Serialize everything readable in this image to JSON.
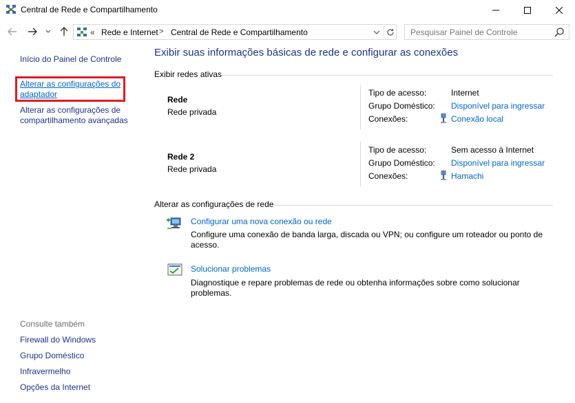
{
  "window": {
    "title": "Central de Rede e Compartilhamento"
  },
  "address": {
    "overflow": "«",
    "crumb1": "Rede e Internet",
    "separator": ">",
    "crumb2": "Central de Rede e Compartilhamento"
  },
  "search": {
    "placeholder": "Pesquisar Painel de Controle"
  },
  "sidebar": {
    "home": "Início do Painel de Controle",
    "adapter": "Alterar as configurações do adaptador",
    "advanced": "Alterar as configurações de compartilhamento avançadas",
    "see_also_title": "Consulte também",
    "see_also": [
      "Firewall do Windows",
      "Grupo Doméstico",
      "Infravermelho",
      "Opções da Internet"
    ]
  },
  "main": {
    "title": "Exibir suas informações básicas de rede e configurar as conexões",
    "active_networks_title": "Exibir redes ativas",
    "networks": [
      {
        "name": "Rede",
        "type": "Rede privada",
        "access_label": "Tipo de acesso:",
        "access_value": "Internet",
        "homegroup_label": "Grupo Doméstico:",
        "homegroup_value": "Disponível para ingressar",
        "connections_label": "Conexões:",
        "connections_value": "Conexão local"
      },
      {
        "name": "Rede  2",
        "type": "Rede privada",
        "access_label": "Tipo de acesso:",
        "access_value": "Sem acesso à Internet",
        "homegroup_label": "Grupo Doméstico:",
        "homegroup_value": "Disponível para ingressar",
        "connections_label": "Conexões:",
        "connections_value": "Hamachi"
      }
    ],
    "change_settings_title": "Alterar as configurações de rede",
    "tasks": [
      {
        "link": "Configurar uma nova conexão ou rede",
        "desc": "Configure uma conexão de banda larga, discada ou VPN; ou configure um roteador ou ponto de acesso."
      },
      {
        "link": "Solucionar problemas",
        "desc": "Diagnostique e repare problemas de rede ou obtenha informações sobre como solucionar problemas."
      }
    ]
  },
  "colors": {
    "link": "#0066cc",
    "nav_link": "#1e3287",
    "highlight": "#e01b24"
  }
}
